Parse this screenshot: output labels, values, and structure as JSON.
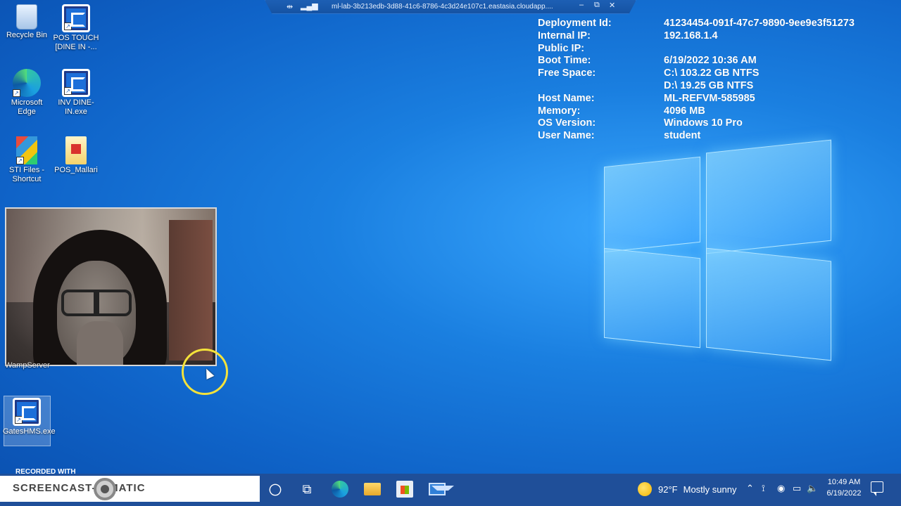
{
  "remote_bar": {
    "pin_glyph": "⇹",
    "signal_glyph": "▂▄▆",
    "title": "ml-lab-3b213edb-3d88-41c6-8786-4c3d24e107c1.eastasia.cloudapp....",
    "minimize_glyph": "–",
    "restore_glyph": "⧉",
    "close_glyph": "✕"
  },
  "desktop_icons": [
    {
      "label": "Recycle Bin",
      "icon": "recycle-bin-icon"
    },
    {
      "label": "POS TOUCH [DINE IN -...",
      "icon": "gates-app-icon"
    },
    {
      "label": "Microsoft Edge",
      "icon": "edge-icon"
    },
    {
      "label": "INV DINE-IN.exe",
      "icon": "gates-app-icon"
    },
    {
      "label": "STI Files - Shortcut",
      "icon": "sti-files-icon"
    },
    {
      "label": "POS_Mallari",
      "icon": "folder-icon"
    },
    {
      "label": "WampServer",
      "icon": "wampserver-icon"
    },
    {
      "label": "GatesHMS.exe",
      "icon": "gates-app-icon"
    }
  ],
  "system_info": {
    "rows": [
      {
        "key": "Deployment Id:",
        "value": "41234454-091f-47c7-9890-9ee9e3f51273"
      },
      {
        "key": "Internal IP:",
        "value": "192.168.1.4"
      },
      {
        "key": "Public IP:",
        "value": ""
      },
      {
        "key": "Boot Time:",
        "value": "6/19/2022 10:36 AM"
      },
      {
        "key": "Free Space:",
        "value": "C:\\ 103.22 GB NTFS"
      },
      {
        "key": "",
        "value": "D:\\ 19.25 GB NTFS"
      },
      {
        "key": "Host Name:",
        "value": "ML-REFVM-585985"
      },
      {
        "key": "Memory:",
        "value": "4096 MB"
      },
      {
        "key": "OS Version:",
        "value": "Windows 10 Pro"
      },
      {
        "key": "User Name:",
        "value": "student"
      }
    ]
  },
  "watermark": {
    "recorded_with": "RECORDED WITH",
    "brand": "SCREENCAST-O-MATIC"
  },
  "taskbar": {
    "icons": [
      "cortana-icon",
      "task-view-icon",
      "edge-icon",
      "file-explorer-icon",
      "store-icon",
      "mail-icon"
    ],
    "task_view_glyph": "⧉",
    "weather": {
      "temp": "92°F",
      "desc": "Mostly sunny",
      "icon": "sun-icon"
    },
    "tray_glyphs": {
      "chevron": "⌃",
      "network": "⟟",
      "meet": "◉",
      "battery": "▭",
      "volume": "🔈"
    },
    "clock": {
      "time": "10:49 AM",
      "date": "6/19/2022"
    },
    "accent": "#1f4f99"
  },
  "colors": {
    "desktop": "#1a7fe0",
    "cursor_ring": "#f4e23a"
  }
}
